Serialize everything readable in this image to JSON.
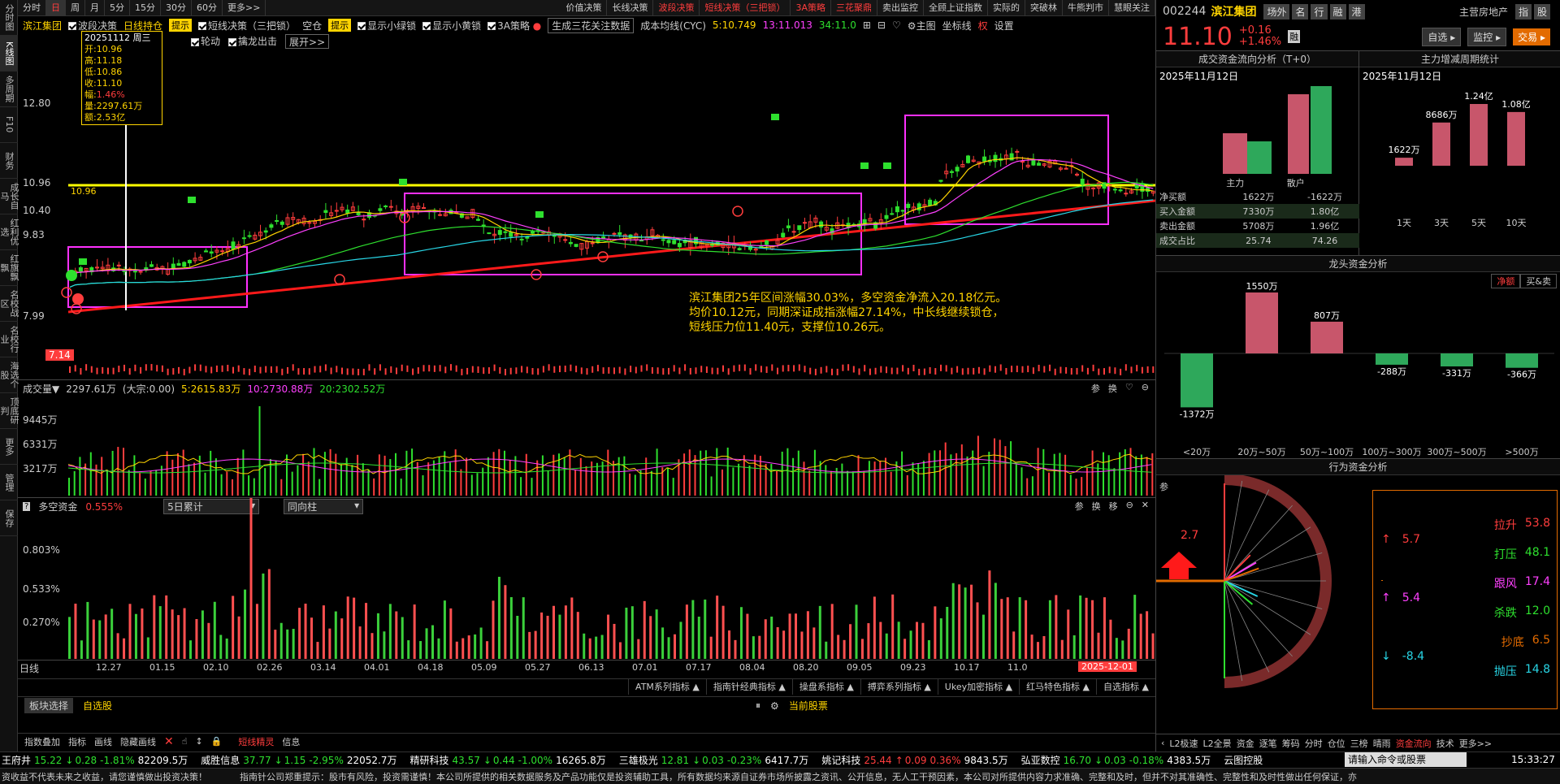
{
  "leftnav": [
    "分时图",
    "K线图",
    "多周期",
    "F10",
    "财务",
    "成长自马",
    "红利优选",
    "红旗飘飘",
    "名校战区",
    "名校行业",
    "海选个股",
    "顶底研判",
    "更多",
    "管理",
    "保存"
  ],
  "top_periods": [
    "分时",
    "日",
    "周",
    "月",
    "5分",
    "15分",
    "30分",
    "60分",
    "更多>>"
  ],
  "top_actions": [
    {
      "label": "价值决策",
      "red": false
    },
    {
      "label": "长线决策",
      "red": false
    },
    {
      "label": "波段决策",
      "red": true
    },
    {
      "label": "短线决策（三把锁）",
      "red": true
    },
    {
      "label": "3A策略",
      "red": true
    },
    {
      "label": "三花聚鼎",
      "red": true
    },
    {
      "label": "卖出监控",
      "red": false
    },
    {
      "label": "全顾上证指数",
      "red": false
    },
    {
      "label": "实际的",
      "red": false
    },
    {
      "label": "突破林",
      "red": false
    },
    {
      "label": "牛熊判市",
      "red": false
    },
    {
      "label": "慧眼关注",
      "red": false
    }
  ],
  "header": {
    "stock_name": "滨江集团",
    "wave": "波段决策",
    "hold": "日线持仓",
    "tip1": "提示",
    "short": "短线决策（三把锁）",
    "empty": "空仓",
    "tip2": "提示",
    "show_green": "显示小绿锁",
    "show_yellow": "显示小黄锁",
    "strategy3a": "3A策略",
    "gen_btn": "生成三花关注数据",
    "cost_label": "成本均线(CYC)",
    "cost_5": "5:10.749",
    "cost_13": "13:11.013",
    "cost_34": "34:11.0",
    "main_fig": "主图",
    "coord": "坐标线",
    "rights": "权",
    "settings": "设置"
  },
  "header2": {
    "wheel": "轮动",
    "catch": "擒龙出击",
    "expand": "展开>>"
  },
  "tooltip": {
    "date": "20251112 周三",
    "open": "开:10.96",
    "high": "高:11.18",
    "low": "低:10.86",
    "close": "收:11.10",
    "amp_label": "幅:",
    "amp": "1.46%",
    "vol": "量:2297.61万",
    "amt": "额:2.53亿"
  },
  "price_axis": {
    "p1": "12.80",
    "p2": "10.96",
    "p3": "10.40",
    "p4": "9.83",
    "p5": "7.99",
    "p6": "7.14",
    "line_label": "10.96"
  },
  "annotation": {
    "l1": "滨江集团25年区间涨幅30.03%，多空资金净流入20.18亿元。",
    "l2": "均价10.12元，同期深证成指涨幅27.14%，中长线继续锁仓，",
    "l3": "短线压力位11.40元，支撑位10.26元。"
  },
  "vol_header": {
    "label": "成交量",
    "arrow": "▼",
    "value": "2297.61万",
    "big": "(大宗:0.00)",
    "ma5": "5:2615.83万",
    "ma10": "10:2730.88万",
    "ma20": "20:2302.52万"
  },
  "vol_axis": [
    "9445万",
    "6331万",
    "3217万"
  ],
  "dk_header": {
    "label": "多空资金",
    "value": "0.555%",
    "sel1": "5日累计",
    "sel2": "同向柱"
  },
  "dk_axis": [
    "0.803%",
    "0.533%",
    "0.270%"
  ],
  "panel_icons": {
    "p1": "参",
    "p2": "换",
    "p3": "移"
  },
  "dates": [
    "12.27",
    "01.15",
    "02.10",
    "02.26",
    "03.14",
    "04.01",
    "04.18",
    "05.09",
    "05.27",
    "06.13",
    "07.01",
    "07.17",
    "08.04",
    "08.20",
    "09.05",
    "09.23",
    "10.17",
    "11.0"
  ],
  "date_axis_label": "日线",
  "date_badge": "2025-12-01",
  "indicators": [
    "ATM系列指标 ▲",
    "指南针经典指标 ▲",
    "操盘系指标 ▲",
    "搏弈系列指标 ▲",
    "Ukey加密指标 ▲",
    "红马特色指标 ▲",
    "自选指标 ▲"
  ],
  "blockbar": {
    "select": "板块选择",
    "custom": "自选股",
    "current": "当前股票"
  },
  "toolbar2": [
    "指数叠加",
    "指标",
    "画线",
    "隐藏画线"
  ],
  "toolbar2_right": [
    "短线精灵",
    "信息"
  ],
  "ticker": [
    {
      "name": "王府井",
      "price": "15.22",
      "chg": "0.28",
      "pct": "-1.81%",
      "vol": "82209.5万",
      "dir": "down"
    },
    {
      "name": "威胜信息",
      "price": "37.77",
      "chg": "1.15",
      "pct": "-2.95%",
      "vol": "22052.7万",
      "dir": "down"
    },
    {
      "name": "精研科技",
      "price": "43.57",
      "chg": "0.44",
      "pct": "-1.00%",
      "vol": "16265.8万",
      "dir": "down"
    },
    {
      "name": "三雄极光",
      "price": "12.81",
      "chg": "0.03",
      "pct": "-0.23%",
      "vol": "6417.7万",
      "dir": "down"
    },
    {
      "name": "姚记科技",
      "price": "25.44",
      "chg": "0.09",
      "pct": "0.36%",
      "vol": "9843.5万",
      "dir": "up"
    },
    {
      "name": "弘亚数控",
      "price": "16.70",
      "chg": "0.03",
      "pct": "-0.18%",
      "vol": "4383.5万",
      "dir": "down"
    },
    {
      "name": "云图控股",
      "price": "",
      "chg": "",
      "pct": "",
      "vol": "",
      "dir": "down"
    }
  ],
  "ticker_input": "请输入命令或股票",
  "clock": "15:33:27",
  "disclaimer1": "资收益不代表未来之收益，请您谨慎做出投资决策！",
  "disclaimer2": "指南针公司郑重提示：股市有风险，投资需谨慎！本公司所提供的相关数据服务及产品功能仅是投资辅助工具，所有数据均来源自证券市场所披露之资讯、公开信息，无人工干预因素，本公司对所提供内容力求准确、完整和及时，但并不对其准确性、完整性和及时性做出任何保证，亦",
  "right": {
    "code": "002244",
    "name": "滨江集团",
    "tabs": [
      "场外",
      "名",
      "行",
      "融",
      "港"
    ],
    "sector": "主营房地产",
    "right_tabs": [
      "指",
      "股"
    ],
    "price": "11.10",
    "chg": "+0.16",
    "pct": "+1.46%",
    "margin_badge": "融",
    "btn_zixuan": "自选",
    "btn_monitor": "监控",
    "btn_trade": "交易",
    "flow_title": "成交资金流向分析（T+0）",
    "cycle_title": "主力增减周期统计",
    "flow_date": "2025年11月12日",
    "cycle_date": "2025年11月12日",
    "flow_bar_main": "主力",
    "flow_bar_retail": "散户",
    "flow_table": [
      [
        "净买额",
        "1622万",
        "-1622万"
      ],
      [
        "买入金额",
        "7330万",
        "1.80亿"
      ],
      [
        "卖出金额",
        "5708万",
        "1.96亿"
      ],
      [
        "成交占比",
        "25.74",
        "74.26"
      ]
    ],
    "cycle_labels": [
      "1天",
      "3天",
      "5天",
      "10天"
    ],
    "cycle_values": [
      "1622万",
      "8686万",
      "1.24亿",
      "1.08亿"
    ],
    "head_title": "龙头资金分析",
    "head_tabs": [
      "净额",
      "买&卖"
    ],
    "head_cats": [
      "<20万",
      "20万~50万",
      "50万~100万",
      "100万~300万",
      "300万~500万",
      ">500万"
    ],
    "head_values": [
      "-1372万",
      "1550万",
      "807万",
      "-288万",
      "-331万",
      "-366万"
    ],
    "behav_title": "行为资金分析",
    "behav_corner": "参",
    "behav_arrow_val": "2.7",
    "behav_left": [
      {
        "arrow": "↑",
        "val": "5.7"
      },
      {
        "arrow": "↑",
        "val": "5.4"
      },
      {
        "arrow": "↓",
        "val": "-8.4"
      }
    ],
    "behav_right": [
      {
        "label": "拉升",
        "val": "53.8"
      },
      {
        "label": "打压",
        "val": "48.1"
      },
      {
        "label": "跟风",
        "val": "17.4"
      },
      {
        "label": "杀跌",
        "val": "12.0"
      },
      {
        "label": "抄底",
        "val": "6.5"
      },
      {
        "label": "抛压",
        "val": "14.8"
      }
    ],
    "bottom_tabs": [
      "L2极速",
      "L2全景",
      "资金",
      "逐笔",
      "筹码",
      "分时",
      "仓位",
      "三榜",
      "晴雨",
      "资金流向",
      "技术",
      "更多>>"
    ]
  },
  "colors": {
    "up": "#ff3d3d",
    "down": "#2ee02e",
    "accent": "#ffd400",
    "magenta": "#ff40ff"
  }
}
